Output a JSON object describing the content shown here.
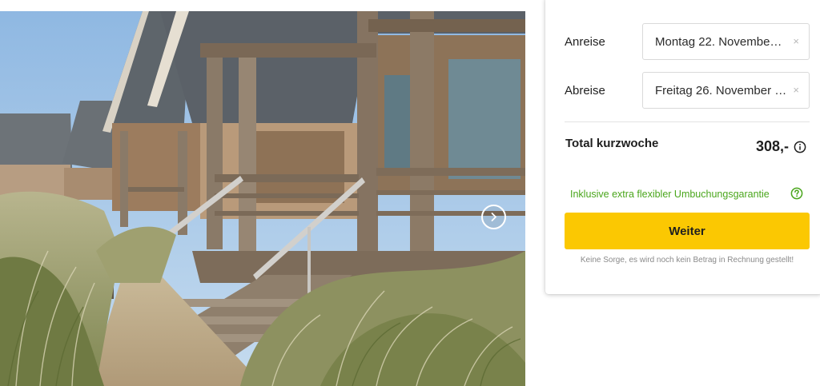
{
  "gallery": {
    "image_alt": "Holiday chalets in the dunes",
    "next_icon": "chevron-right-icon"
  },
  "booking": {
    "arrival": {
      "label": "Anreise",
      "value": "Montag 22. Novembe…",
      "clear": "×"
    },
    "departure": {
      "label": "Abreise",
      "value": "Freitag 26. November …",
      "clear": "×"
    },
    "total": {
      "label": "Total kurzwoche",
      "price": "308,-",
      "info_icon": "info-circle-icon"
    },
    "guarantee": {
      "text": "Inklusive extra flexibler Umbuchungsgarantie",
      "icon": "question-circle-icon"
    },
    "continue_label": "Weiter",
    "note": "Keine Sorge, es wird noch kein Betrag in Rechnung gestellt!"
  },
  "colors": {
    "accent_yellow": "#fbc802",
    "guarantee_green": "#4aa61c",
    "text_dark": "#1f1f1f",
    "muted_gray": "#8a8a8a"
  }
}
